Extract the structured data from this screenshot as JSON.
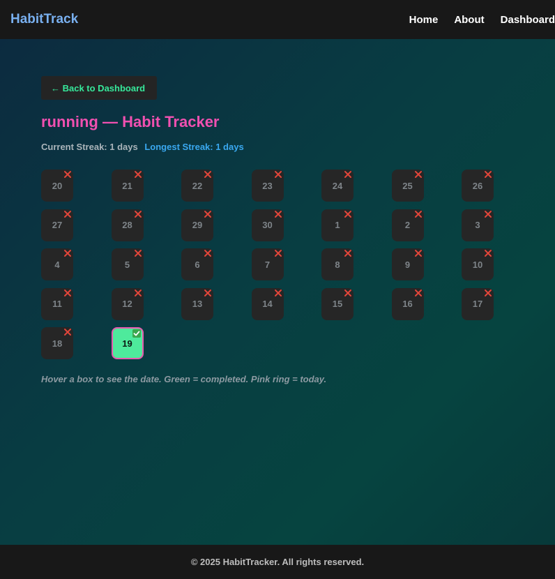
{
  "navbar": {
    "brand": "HabitTrack",
    "links": [
      "Home",
      "About",
      "Dashboard"
    ]
  },
  "back_button": "← Back to Dashboard",
  "title": "running — Habit Tracker",
  "streaks": {
    "current": "Current Streak: 1 days",
    "longest": "Longest Streak: 1 days"
  },
  "days": [
    {
      "label": "20",
      "status": "missed"
    },
    {
      "label": "21",
      "status": "missed"
    },
    {
      "label": "22",
      "status": "missed"
    },
    {
      "label": "23",
      "status": "missed"
    },
    {
      "label": "24",
      "status": "missed"
    },
    {
      "label": "25",
      "status": "missed"
    },
    {
      "label": "26",
      "status": "missed"
    },
    {
      "label": "27",
      "status": "missed"
    },
    {
      "label": "28",
      "status": "missed"
    },
    {
      "label": "29",
      "status": "missed"
    },
    {
      "label": "30",
      "status": "missed"
    },
    {
      "label": "1",
      "status": "missed"
    },
    {
      "label": "2",
      "status": "missed"
    },
    {
      "label": "3",
      "status": "missed"
    },
    {
      "label": "4",
      "status": "missed"
    },
    {
      "label": "5",
      "status": "missed"
    },
    {
      "label": "6",
      "status": "missed"
    },
    {
      "label": "7",
      "status": "missed"
    },
    {
      "label": "8",
      "status": "missed"
    },
    {
      "label": "9",
      "status": "missed"
    },
    {
      "label": "10",
      "status": "missed"
    },
    {
      "label": "11",
      "status": "missed"
    },
    {
      "label": "12",
      "status": "missed"
    },
    {
      "label": "13",
      "status": "missed"
    },
    {
      "label": "14",
      "status": "missed"
    },
    {
      "label": "15",
      "status": "missed"
    },
    {
      "label": "16",
      "status": "missed"
    },
    {
      "label": "17",
      "status": "missed"
    },
    {
      "label": "18",
      "status": "missed"
    },
    {
      "label": "19",
      "status": "completed",
      "today": true
    }
  ],
  "hint": "Hover a box to see the date. Green = completed. Pink ring = today.",
  "footer": "© 2025 HabitTracker. All rights reserved.",
  "colors": {
    "brand": "#79b0f0",
    "accent_pink": "#f050b0",
    "completed_green": "#4eea9c",
    "today_ring": "#e65aae",
    "missed_icon": "#e2463a",
    "link_green": "#36e89b",
    "longest_blue": "#3aa8f0"
  },
  "icons": {
    "missed": "cross-mark-icon",
    "completed": "check-mark-icon"
  }
}
